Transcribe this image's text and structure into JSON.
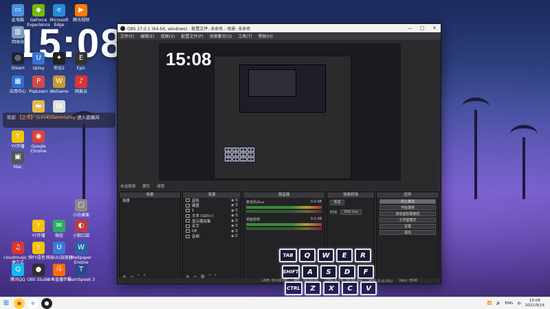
{
  "desktop": {
    "clock": "15:08",
    "icons": [
      {
        "label": "此电脑",
        "glyph": "▭",
        "color": "#4a8fe0"
      },
      {
        "label": "GeForce Experience",
        "glyph": "◆",
        "color": "#76b900"
      },
      {
        "label": "Microsoft Edge",
        "glyph": "e",
        "color": "#2a8ad8"
      },
      {
        "label": "腾讯视频",
        "glyph": "▶",
        "color": "#ff7a00"
      },
      {
        "label": "回收站",
        "glyph": "▥",
        "color": "#7a9cc0"
      },
      {
        "label": "Steam",
        "glyph": "◎",
        "color": "#1b2838"
      },
      {
        "label": "Uplay",
        "glyph": "U",
        "color": "#3a6fd0"
      },
      {
        "label": "命运2",
        "glyph": "✦",
        "color": "#222"
      },
      {
        "label": "Epic",
        "glyph": "E",
        "color": "#333"
      },
      {
        "label": "应用中心",
        "glyph": "▦",
        "color": "#2f6fd8"
      },
      {
        "label": "PopLearn",
        "glyph": "P",
        "color": "#d04a4a"
      },
      {
        "label": "WeGame",
        "glyph": "W",
        "color": "#c79a30"
      },
      {
        "label": "网易云",
        "glyph": "♪",
        "color": "#d33"
      },
      {
        "label": "新建文件夹",
        "glyph": "▬",
        "color": "#e8b84a"
      },
      {
        "label": "新建文本文档",
        "glyph": "▤",
        "color": "#ddd"
      },
      {
        "label": "YY开播",
        "glyph": "Y",
        "color": "#f4c300"
      },
      {
        "label": "Mac",
        "glyph": "▣",
        "color": "#555"
      },
      {
        "label": "Google Chrome",
        "glyph": "◉",
        "color": "#db4437"
      },
      {
        "label": "小白桌面",
        "glyph": "▢",
        "color": "#888"
      },
      {
        "label": "YY开播",
        "glyph": "Y",
        "color": "#f4c300"
      },
      {
        "label": "微信",
        "glyph": "✉",
        "color": "#2aae67"
      },
      {
        "label": "小狼口袋",
        "glyph": "◐",
        "color": "#c03a3a"
      },
      {
        "label": "cloudmusic 快捷方式",
        "glyph": "♫",
        "color": "#d33"
      },
      {
        "label": "YY语音",
        "glyph": "Y",
        "color": "#f4c300"
      },
      {
        "label": "网易UU加速器",
        "glyph": "U",
        "color": "#3a7bd5"
      },
      {
        "label": "Wallpaper Engine",
        "glyph": "W",
        "color": "#2a64a8"
      },
      {
        "label": "腾讯QQ",
        "glyph": "Q",
        "color": "#12b7f5"
      },
      {
        "label": "OBS Studio",
        "glyph": "●",
        "color": "#302e31"
      },
      {
        "label": "斗鱼直播伴侣",
        "glyph": "斗",
        "color": "#ff6a00"
      },
      {
        "label": "TeamSpeak 3",
        "glyph": "T",
        "color": "#2a4a8a"
      }
    ],
    "notification": {
      "prefix": "欢迎",
      "highlight": "【正常】 [LV54]Gammaray",
      "suffix": "进入直播间"
    }
  },
  "obs": {
    "title": "OBS 27.0.1 (64-bit, windows) - 配置文件: 未命名 - 场景: 未命名",
    "menu": [
      "文件(F)",
      "编辑(E)",
      "视图(V)",
      "配置文件(P)",
      "场景集合(S)",
      "工具(T)",
      "帮助(H)"
    ],
    "window_controls": [
      "—",
      "▢",
      "✕"
    ],
    "preview": {
      "clock": "15:08"
    },
    "status_line": [
      "未选择源",
      "属性",
      "滤镜"
    ],
    "panels": {
      "scenes": {
        "title": "场景",
        "items": [
          "场景"
        ]
      },
      "sources": {
        "title": "来源",
        "items": [
          "音轨",
          "键盘",
          "1",
          "文本 (GDI+)",
          "显示器采集",
          "名字",
          "DE",
          "音频"
        ]
      },
      "mixer": {
        "title": "混音器",
        "tracks": [
          {
            "name": "麦克风/Aux",
            "db": "0.0 dB"
          },
          {
            "name": "桌面音频",
            "db": "0.0 dB"
          }
        ]
      },
      "transitions": {
        "title": "场景转场",
        "type": "渐变",
        "duration_label": "时长",
        "duration": "300 ms"
      },
      "controls": {
        "title": "控件",
        "buttons": [
          "停止推流",
          "开始录制",
          "启动虚拟摄像机",
          "工作室模式",
          "设置",
          "退出"
        ]
      }
    },
    "statusbar": [
      "LIVE: 00:00:00",
      "REC: 00:00:00",
      "CPU: 6.1%, 30.00 fps",
      "延迟: 0 (0.0%)",
      "kb/s: 3500"
    ]
  },
  "keyboard_overlay": {
    "rows": [
      [
        "TAB",
        "Q",
        "W",
        "E",
        "R"
      ],
      [
        "SHIFT",
        "A",
        "S",
        "D",
        "F"
      ],
      [
        "CTRL",
        "Z",
        "X",
        "C",
        "V"
      ]
    ]
  },
  "taskbar": {
    "tray_items": [
      "ENG",
      "中"
    ],
    "time": "15:08",
    "date": "2021/9/16"
  }
}
